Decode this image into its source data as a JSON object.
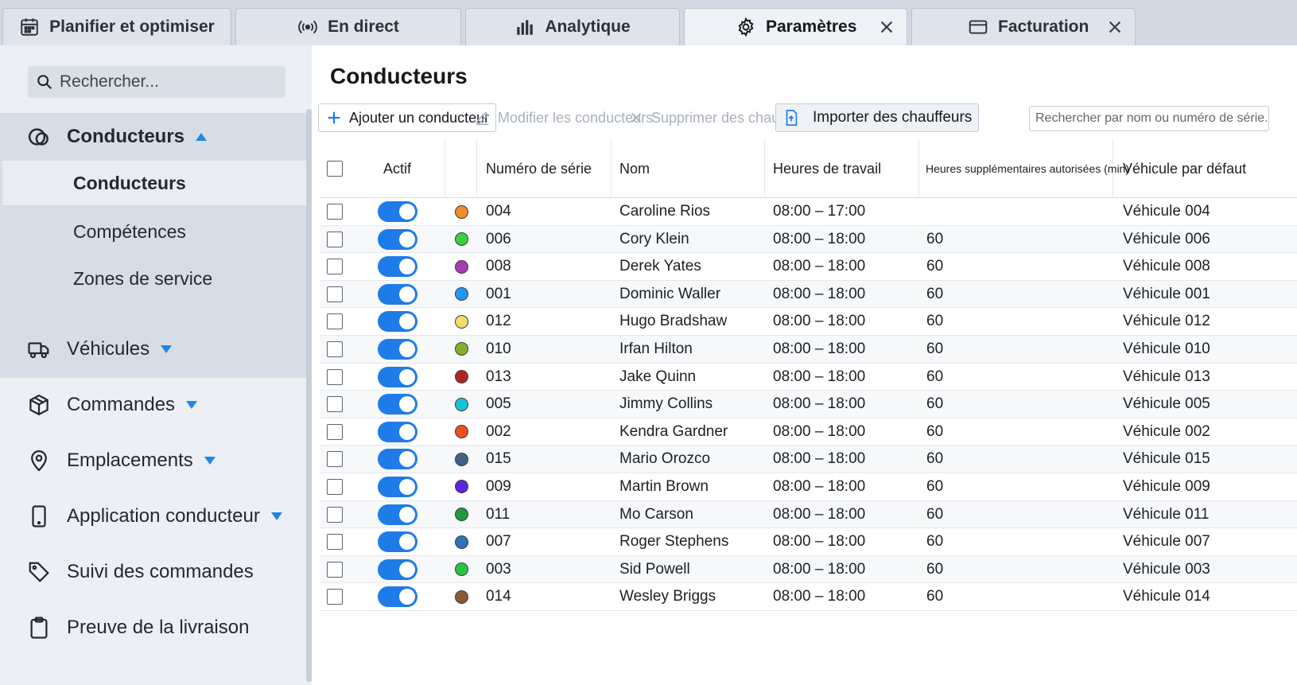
{
  "tabs": [
    {
      "label": "Planifier et optimiser",
      "icon": "calendar-icon",
      "closable": false,
      "active": false
    },
    {
      "label": "En direct",
      "icon": "broadcast-icon",
      "closable": false,
      "active": false
    },
    {
      "label": "Analytique",
      "icon": "bar-chart-icon",
      "closable": false,
      "active": false
    },
    {
      "label": "Paramètres",
      "icon": "gear-icon",
      "closable": true,
      "active": true
    },
    {
      "label": "Facturation",
      "icon": "credit-card-icon",
      "closable": true,
      "active": false
    }
  ],
  "sidebar": {
    "search_placeholder": "Rechercher...",
    "drivers_section": {
      "label": "Conducteurs",
      "icon": "steering-wheel-icon"
    },
    "sub_items": [
      {
        "label": "Conducteurs",
        "active": true
      },
      {
        "label": "Compétences",
        "active": false
      },
      {
        "label": "Zones de service",
        "active": false
      }
    ],
    "items": [
      {
        "label": "Véhicules",
        "icon": "truck-icon",
        "caret": true
      },
      {
        "label": "Commandes",
        "icon": "box-icon",
        "caret": true
      },
      {
        "label": "Emplacements",
        "icon": "map-pin-icon",
        "caret": true
      },
      {
        "label": "Application conducteur",
        "icon": "phone-icon",
        "caret": true
      },
      {
        "label": "Suivi des commandes",
        "icon": "tag-icon",
        "caret": false
      },
      {
        "label": "Preuve de la livraison",
        "icon": "clipboard-icon",
        "caret": false
      }
    ]
  },
  "main": {
    "title": "Conducteurs",
    "toolbar": {
      "add_label": "Ajouter un conducteur",
      "edit_label": "Modifier les conducteurs",
      "delete_label": "Supprimer des chauffeurs",
      "import_label": "Importer des chauffeurs",
      "search_placeholder": "Rechercher par nom ou numéro de série..."
    },
    "columns": {
      "active": "Actif",
      "serial": "Numéro de série",
      "name": "Nom",
      "hours": "Heures de travail",
      "overtime": "Heures supplémentaires autorisées (min)",
      "vehicle": "Véhicule par défaut"
    },
    "rows": [
      {
        "serial": "004",
        "name": "Caroline Rios",
        "hours": "08:00 – 17:00",
        "overtime": "",
        "vehicle": "Véhicule 004",
        "color": "#f28c28",
        "active": true
      },
      {
        "serial": "006",
        "name": "Cory Klein",
        "hours": "08:00 – 18:00",
        "overtime": "60",
        "vehicle": "Véhicule 006",
        "color": "#3ccf3c",
        "active": true
      },
      {
        "serial": "008",
        "name": "Derek Yates",
        "hours": "08:00 – 18:00",
        "overtime": "60",
        "vehicle": "Véhicule 008",
        "color": "#a93bb0",
        "active": true
      },
      {
        "serial": "001",
        "name": "Dominic Waller",
        "hours": "08:00 – 18:00",
        "overtime": "60",
        "vehicle": "Véhicule 001",
        "color": "#2196f3",
        "active": true
      },
      {
        "serial": "012",
        "name": "Hugo Bradshaw",
        "hours": "08:00 – 18:00",
        "overtime": "60",
        "vehicle": "Véhicule 012",
        "color": "#f5dc6a",
        "active": true
      },
      {
        "serial": "010",
        "name": "Irfan Hilton",
        "hours": "08:00 – 18:00",
        "overtime": "60",
        "vehicle": "Véhicule 010",
        "color": "#86b02b",
        "active": true
      },
      {
        "serial": "013",
        "name": "Jake Quinn",
        "hours": "08:00 – 18:00",
        "overtime": "60",
        "vehicle": "Véhicule 013",
        "color": "#b3261e",
        "active": true
      },
      {
        "serial": "005",
        "name": "Jimmy Collins",
        "hours": "08:00 – 18:00",
        "overtime": "60",
        "vehicle": "Véhicule 005",
        "color": "#19c2d6",
        "active": true
      },
      {
        "serial": "002",
        "name": "Kendra Gardner",
        "hours": "08:00 – 18:00",
        "overtime": "60",
        "vehicle": "Véhicule 002",
        "color": "#f2501e",
        "active": true
      },
      {
        "serial": "015",
        "name": "Mario Orozco",
        "hours": "08:00 – 18:00",
        "overtime": "60",
        "vehicle": "Véhicule 015",
        "color": "#3f6285",
        "active": true
      },
      {
        "serial": "009",
        "name": "Martin Brown",
        "hours": "08:00 – 18:00",
        "overtime": "60",
        "vehicle": "Véhicule 009",
        "color": "#5a25e0",
        "active": true
      },
      {
        "serial": "011",
        "name": "Mo Carson",
        "hours": "08:00 – 18:00",
        "overtime": "60",
        "vehicle": "Véhicule 011",
        "color": "#1d9a3a",
        "active": true
      },
      {
        "serial": "007",
        "name": "Roger Stephens",
        "hours": "08:00 – 18:00",
        "overtime": "60",
        "vehicle": "Véhicule 007",
        "color": "#2f72b8",
        "active": true
      },
      {
        "serial": "003",
        "name": "Sid Powell",
        "hours": "08:00 – 18:00",
        "overtime": "60",
        "vehicle": "Véhicule 003",
        "color": "#2bc43f",
        "active": true
      },
      {
        "serial": "014",
        "name": "Wesley Briggs",
        "hours": "08:00 – 18:00",
        "overtime": "60",
        "vehicle": "Véhicule 014",
        "color": "#8a5a34",
        "active": true
      }
    ]
  },
  "colors": {
    "accent": "#1e7be8",
    "caret": "#1e88e5"
  }
}
